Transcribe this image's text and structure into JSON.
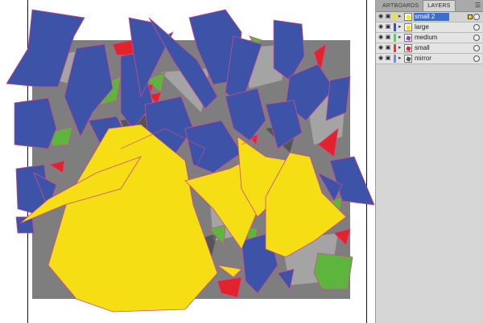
{
  "panel": {
    "tabs": [
      {
        "label": "ARTBOARDS",
        "active": false
      },
      {
        "label": "LAYERS",
        "active": true
      }
    ],
    "menu_icon": "panel-menu-icon",
    "layers": [
      {
        "name": "small 2",
        "color": "#f5e800",
        "selected": true
      },
      {
        "name": "large",
        "color": "#2f55d4",
        "selected": false
      },
      {
        "name": "medium",
        "color": "#5cd05c",
        "selected": false
      },
      {
        "name": "small",
        "color": "#e83a3a",
        "selected": false
      },
      {
        "name": "mirror",
        "color": "#6d8fe8",
        "selected": false
      }
    ]
  },
  "artwork": {
    "colors": {
      "blue": "#3c53a8",
      "yellow": "#f5de14",
      "green": "#5db53d",
      "red": "#e3232c",
      "outline": "#d04a8c",
      "photo": "#8a8a8a"
    }
  }
}
